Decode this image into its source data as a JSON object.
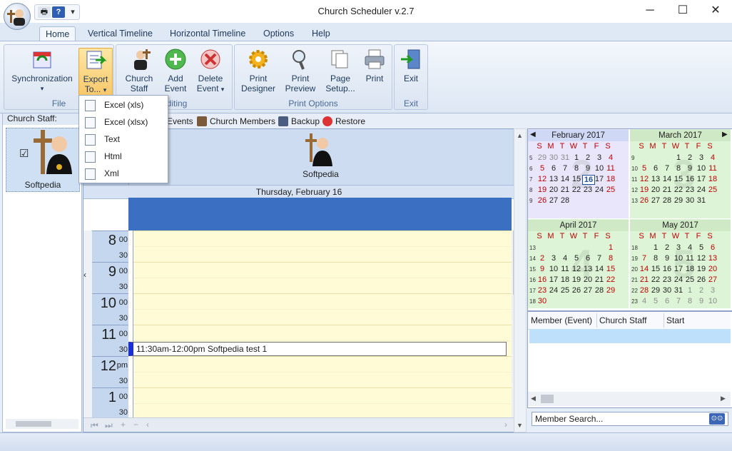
{
  "window": {
    "title": "Church Scheduler v.2.7",
    "minimize": "─",
    "maximize": "☐",
    "close": "✕"
  },
  "qat": {
    "print_icon": "printer-icon",
    "help_icon": "help-icon",
    "help_label": "?",
    "customize": "▾"
  },
  "tabs": [
    {
      "label": "Home",
      "active": true
    },
    {
      "label": "Vertical Timeline"
    },
    {
      "label": "Horizontal Timeline"
    },
    {
      "label": "Options"
    },
    {
      "label": "Help"
    }
  ],
  "ribbon": {
    "groups": {
      "file": "File",
      "editing": "Editing",
      "print_options": "Print Options",
      "exit": "Exit"
    },
    "buttons": {
      "synchronization": "Synchronization",
      "export_line1": "Export",
      "export_line2": "To...",
      "church_staff_line1": "Church",
      "church_staff_line2": "Staff",
      "add_event_line1": "Add",
      "add_event_line2": "Event",
      "delete_event_line1": "Delete",
      "delete_event_line2": "Event",
      "print_designer_line1": "Print",
      "print_designer_line2": "Designer",
      "print_preview_line1": "Print",
      "print_preview_line2": "Preview",
      "page_setup_line1": "Page",
      "page_setup_line2": "Setup...",
      "print": "Print",
      "exit": "Exit",
      "arrow": "▾"
    }
  },
  "export_menu": [
    "Excel (xls)",
    "Excel (xlsx)",
    "Text",
    "Html",
    "Xml"
  ],
  "left_panel": {
    "header": "Church Staff:",
    "staff_name": "Softpedia",
    "checkbox": "☑"
  },
  "toolbar": {
    "events": "Events",
    "church_members": "Church Members",
    "backup": "Backup",
    "restore": "Restore"
  },
  "day_view": {
    "resource": "Softpedia",
    "date": "Thursday, February 16",
    "collapse_arrow": "‹",
    "hours": [
      {
        "h": "8",
        "m": "00"
      },
      {
        "h": "9",
        "m": "00"
      },
      {
        "h": "10",
        "m": "00"
      },
      {
        "h": "11",
        "m": "00"
      },
      {
        "h": "12",
        "m": "pm"
      },
      {
        "h": "1",
        "m": "00"
      }
    ],
    "half": "30",
    "event": "11:30am-12:00pm Softpedia test 1",
    "nav": {
      "first": "⏮",
      "prev": "⏭",
      "add": "+",
      "remove": "−",
      "check": "✓",
      "x": "✕",
      "left": "‹",
      "right": "›"
    }
  },
  "calendars": {
    "dow": [
      "S",
      "M",
      "T",
      "W",
      "T",
      "F",
      "S"
    ],
    "prev": "◀",
    "next": "▶",
    "months": [
      {
        "name": "February 2017",
        "bg": "#e9e6fb",
        "head": "#cfd8f5",
        "watermark": "2",
        "weeks": [
          "5",
          "6",
          "7",
          "8",
          "9"
        ],
        "rows": [
          [
            "29",
            "30",
            "31",
            "1",
            "2",
            "3",
            "4"
          ],
          [
            "5",
            "6",
            "7",
            "8",
            "9",
            "10",
            "11"
          ],
          [
            "12",
            "13",
            "14",
            "15",
            "16",
            "17",
            "18"
          ],
          [
            "19",
            "20",
            "21",
            "22",
            "23",
            "24",
            "25"
          ],
          [
            "26",
            "27",
            "28",
            "",
            "",
            "",
            ""
          ]
        ],
        "gray_first": 3,
        "today": "16"
      },
      {
        "name": "March 2017",
        "bg": "#ddf5d6",
        "head": "#cfe8c6",
        "watermark": "3",
        "weeks": [
          "9",
          "10",
          "11",
          "12",
          "13"
        ],
        "rows": [
          [
            "",
            "",
            "",
            "1",
            "2",
            "3",
            "4"
          ],
          [
            "5",
            "6",
            "7",
            "8",
            "9",
            "10",
            "11"
          ],
          [
            "12",
            "13",
            "14",
            "15",
            "16",
            "17",
            "18"
          ],
          [
            "19",
            "20",
            "21",
            "22",
            "23",
            "24",
            "25"
          ],
          [
            "26",
            "27",
            "28",
            "29",
            "30",
            "31",
            ""
          ]
        ]
      },
      {
        "name": "April 2017",
        "bg": "#ddf5d6",
        "head": "#cfe8c6",
        "watermark": "4",
        "weeks": [
          "13",
          "14",
          "15",
          "16",
          "17",
          "18"
        ],
        "rows": [
          [
            "",
            "",
            "",
            "",
            "",
            "",
            "1"
          ],
          [
            "2",
            "3",
            "4",
            "5",
            "6",
            "7",
            "8"
          ],
          [
            "9",
            "10",
            "11",
            "12",
            "13",
            "14",
            "15"
          ],
          [
            "16",
            "17",
            "18",
            "19",
            "20",
            "21",
            "22"
          ],
          [
            "23",
            "24",
            "25",
            "26",
            "27",
            "28",
            "29"
          ],
          [
            "30",
            "",
            "",
            "",
            "",
            "",
            ""
          ]
        ]
      },
      {
        "name": "May 2017",
        "bg": "#ddf5d6",
        "head": "#cfe8c6",
        "watermark": "5",
        "weeks": [
          "18",
          "19",
          "20",
          "21",
          "22",
          "23"
        ],
        "rows": [
          [
            "",
            "1",
            "2",
            "3",
            "4",
            "5",
            "6"
          ],
          [
            "7",
            "8",
            "9",
            "10",
            "11",
            "12",
            "13"
          ],
          [
            "14",
            "15",
            "16",
            "17",
            "18",
            "19",
            "20"
          ],
          [
            "21",
            "22",
            "23",
            "24",
            "25",
            "26",
            "27"
          ],
          [
            "28",
            "29",
            "30",
            "31",
            "1",
            "2",
            "3"
          ],
          [
            "4",
            "5",
            "6",
            "7",
            "8",
            "9",
            "10"
          ]
        ],
        "gray_tail": true
      }
    ]
  },
  "members_grid": {
    "columns": [
      "Member (Event)",
      "Church Staff",
      "Start"
    ]
  },
  "search": {
    "placeholder": "Member Search...",
    "icon": "binoculars-icon"
  }
}
